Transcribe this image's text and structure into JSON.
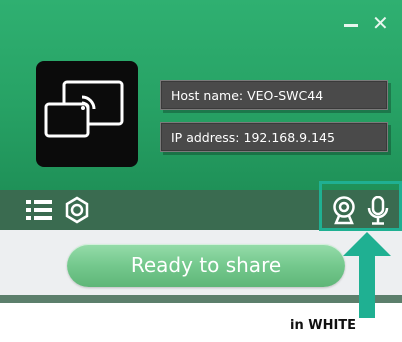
{
  "window": {
    "minimize_icon": "minimize-icon",
    "close_icon": "close-icon",
    "close_glyph": "✕"
  },
  "header": {
    "logo_icon": "screen-cast-icon",
    "host_name": "Host name: VEO-SWC44",
    "ip_address": "IP address: 192.168.9.145"
  },
  "toolbar": {
    "menu_icon": "list-menu-icon",
    "settings_icon": "gear-icon",
    "camera_icon": "webcam-icon",
    "microphone_icon": "microphone-icon"
  },
  "main": {
    "share_button_label": "Ready to share"
  },
  "annotation": {
    "caption": "in WHITE",
    "arrow_icon": "up-arrow-icon",
    "highlight_color": "#1fb092"
  },
  "colors": {
    "header_green": "#27a265",
    "toolbar": "#3a6b50",
    "button_green": "#74c88d"
  }
}
